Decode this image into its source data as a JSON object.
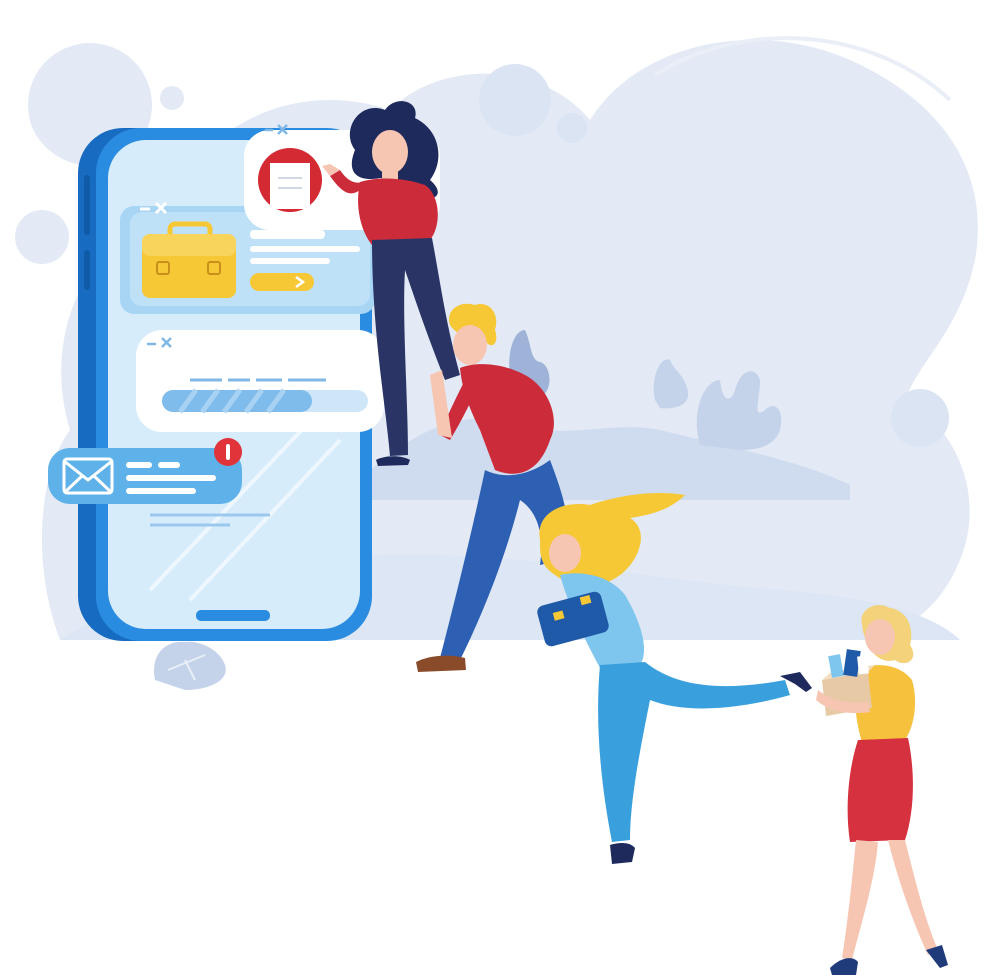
{
  "illustration": {
    "colors": {
      "background_blob": "#e3eaf5",
      "blob_light": "#edf2fa",
      "phone_frame": "#1e7fd4",
      "phone_screen": "#d6ecfb",
      "card": "#ffffff",
      "card_blue": "#b9dcf6",
      "briefcase": "#f6c836",
      "notification_red": "#e0333a",
      "skin": "#f7c6b3",
      "hair_dark": "#1f2a5c",
      "hair_blonde": "#f6c836",
      "shirt_red": "#cc2b3a",
      "jeans": "#2d5fb3",
      "pants_navy": "#2a3566",
      "top_light_blue": "#7fc6ef",
      "top_yellow": "#f6c13d",
      "skirt_red": "#d6313f",
      "box": "#e7c9a5"
    },
    "icons": [
      "close-icon",
      "briefcase-icon",
      "arrow-right-icon",
      "envelope-icon",
      "notification-badge-icon",
      "document-icon"
    ],
    "figures": [
      "woman-dark-hair-pointing",
      "man-blonde-running",
      "woman-blonde-running-briefcase",
      "woman-carrying-box"
    ]
  }
}
